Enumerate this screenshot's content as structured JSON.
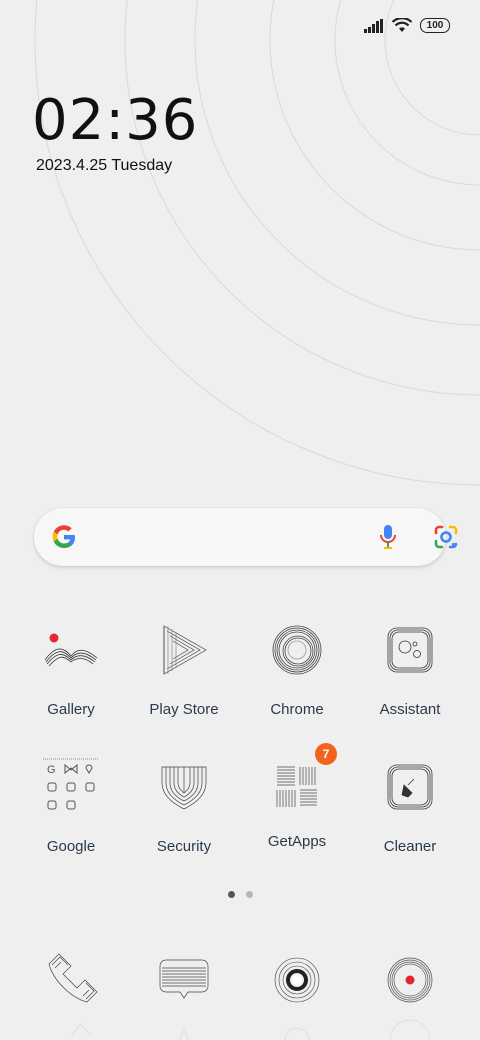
{
  "status_bar": {
    "signal_icon": "signal-bars-icon",
    "wifi_icon": "wifi-icon",
    "battery_level": "100"
  },
  "clock": {
    "time": "02:36",
    "date": "2023.4.25 Tuesday"
  },
  "search": {
    "logo_icon": "google-g-icon",
    "mic_icon": "microphone-icon",
    "lens_icon": "google-lens-icon"
  },
  "apps": [
    {
      "label": "Gallery",
      "icon": "gallery-icon"
    },
    {
      "label": "Play Store",
      "icon": "play-store-icon"
    },
    {
      "label": "Chrome",
      "icon": "chrome-icon"
    },
    {
      "label": "Assistant",
      "icon": "assistant-icon"
    },
    {
      "label": "Google",
      "icon": "google-folder-icon"
    },
    {
      "label": "Security",
      "icon": "security-icon"
    },
    {
      "label": "GetApps",
      "icon": "getapps-icon",
      "badge": "7"
    },
    {
      "label": "Cleaner",
      "icon": "cleaner-icon"
    }
  ],
  "page_indicator": {
    "pages": 2,
    "active": 1
  },
  "dock": [
    {
      "icon": "phone-icon"
    },
    {
      "icon": "messaging-icon"
    },
    {
      "icon": "browser-icon"
    },
    {
      "icon": "camera-icon"
    }
  ],
  "colors": {
    "background": "#efefef",
    "badge": "#f2641c",
    "label_text": "#2b3a4a"
  }
}
